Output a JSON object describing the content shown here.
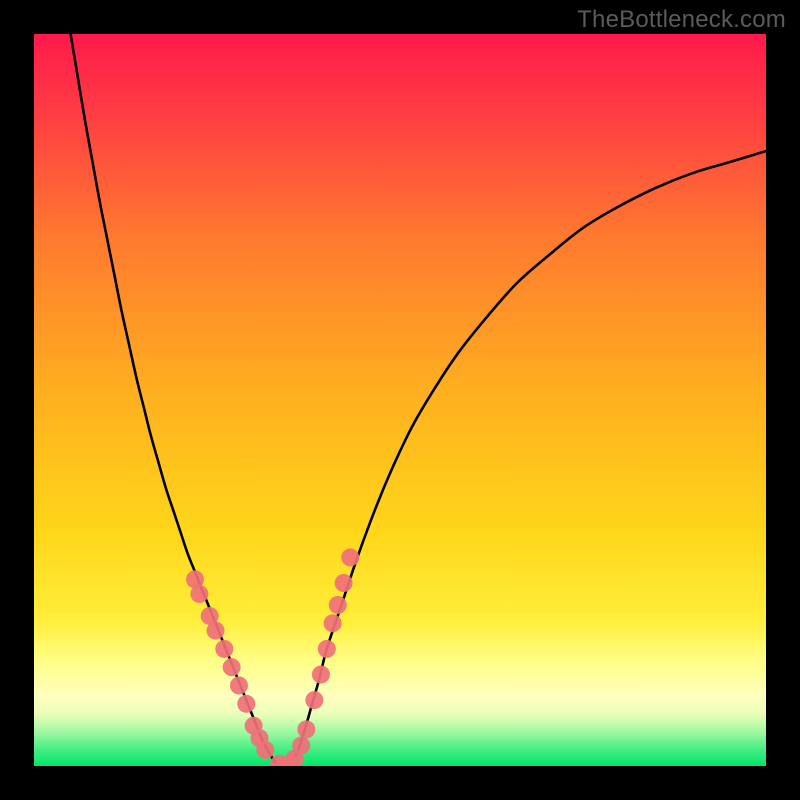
{
  "watermark": "TheBottleneck.com",
  "chart_data": {
    "type": "line",
    "title": "",
    "xlabel": "",
    "ylabel": "",
    "xlim": [
      0,
      100
    ],
    "ylim": [
      0,
      100
    ],
    "grid": false,
    "legend": false,
    "background_gradient": {
      "top_color": "#ff1a4b",
      "mid_upper_color": "#ff7a2f",
      "mid_color": "#ffd41f",
      "band_color": "#ffff8a",
      "bottom_color": "#00e76a"
    },
    "series": [
      {
        "name": "bottleneck-curve",
        "color": "#000000",
        "x": [
          5,
          6,
          7,
          8,
          9,
          10,
          11,
          12,
          13,
          14,
          15,
          16,
          17,
          18,
          19,
          20,
          21,
          22,
          23,
          24,
          25,
          26,
          27,
          28,
          29,
          30,
          31,
          32,
          33,
          34,
          35,
          36,
          37,
          38,
          39,
          40,
          42,
          44,
          46,
          48,
          50,
          52,
          55,
          58,
          62,
          66,
          70,
          75,
          80,
          85,
          90,
          95,
          100
        ],
        "y": [
          100,
          94,
          88,
          82.5,
          77,
          72,
          67,
          62,
          57.5,
          53,
          49,
          45,
          41.5,
          38,
          35,
          32,
          29,
          26.5,
          24,
          21.5,
          19,
          16.5,
          14,
          11.5,
          9,
          6.5,
          4,
          2,
          0.5,
          0,
          0.5,
          2,
          5,
          8.5,
          12,
          16,
          22,
          28,
          33.5,
          38.5,
          43,
          47,
          52,
          56.5,
          61.5,
          66,
          69.5,
          73.5,
          76.5,
          79,
          81,
          82.5,
          84
        ]
      }
    ],
    "scatter": [
      {
        "name": "datapoints",
        "color": "#f07078",
        "radius": 9,
        "x": [
          22,
          22.6,
          24,
          24.8,
          26,
          27,
          28,
          29,
          30,
          30.8,
          31.6,
          33.5,
          34.2,
          35,
          35.6,
          36.5,
          37.2,
          38.3,
          39.2,
          40,
          40.8,
          41.5,
          42.3,
          43.2
        ],
        "y": [
          25.5,
          23.5,
          20.5,
          18.5,
          16,
          13.5,
          11,
          8.5,
          5.5,
          3.8,
          2.2,
          0.3,
          0.1,
          0.3,
          1,
          2.8,
          5,
          9,
          12.5,
          16,
          19.5,
          22,
          25,
          28.5
        ]
      }
    ]
  }
}
